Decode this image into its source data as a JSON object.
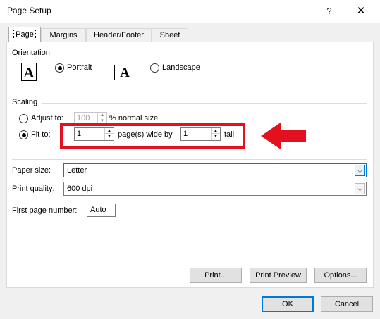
{
  "window": {
    "title": "Page Setup",
    "help_label": "?",
    "close_label": "✕"
  },
  "tabs": [
    {
      "label": "Page",
      "active": true
    },
    {
      "label": "Margins"
    },
    {
      "label": "Header/Footer"
    },
    {
      "label": "Sheet"
    }
  ],
  "orientation": {
    "group_label": "Orientation",
    "portrait_label": "Portrait",
    "landscape_label": "Landscape",
    "selected": "Portrait",
    "icon_letter": "A"
  },
  "scaling": {
    "group_label": "Scaling",
    "adjust_to_label": "Adjust to:",
    "adjust_value": "100",
    "normal_size_label": "% normal size",
    "fit_to_label": "Fit to:",
    "pages_wide_value": "1",
    "pages_wide_label": "page(s) wide by",
    "pages_tall_value": "1",
    "tall_label": "tall",
    "selected": "Fit to"
  },
  "paper_size": {
    "label": "Paper size:",
    "value": "Letter"
  },
  "print_quality": {
    "label": "Print quality:",
    "value": "600 dpi"
  },
  "first_page_number": {
    "label": "First page number:",
    "value": "Auto"
  },
  "buttons": {
    "print": "Print...",
    "print_preview": "Print Preview",
    "options": "Options...",
    "ok": "OK",
    "cancel": "Cancel"
  },
  "colors": {
    "highlight": "#e3101e",
    "focus": "#0078d7"
  }
}
